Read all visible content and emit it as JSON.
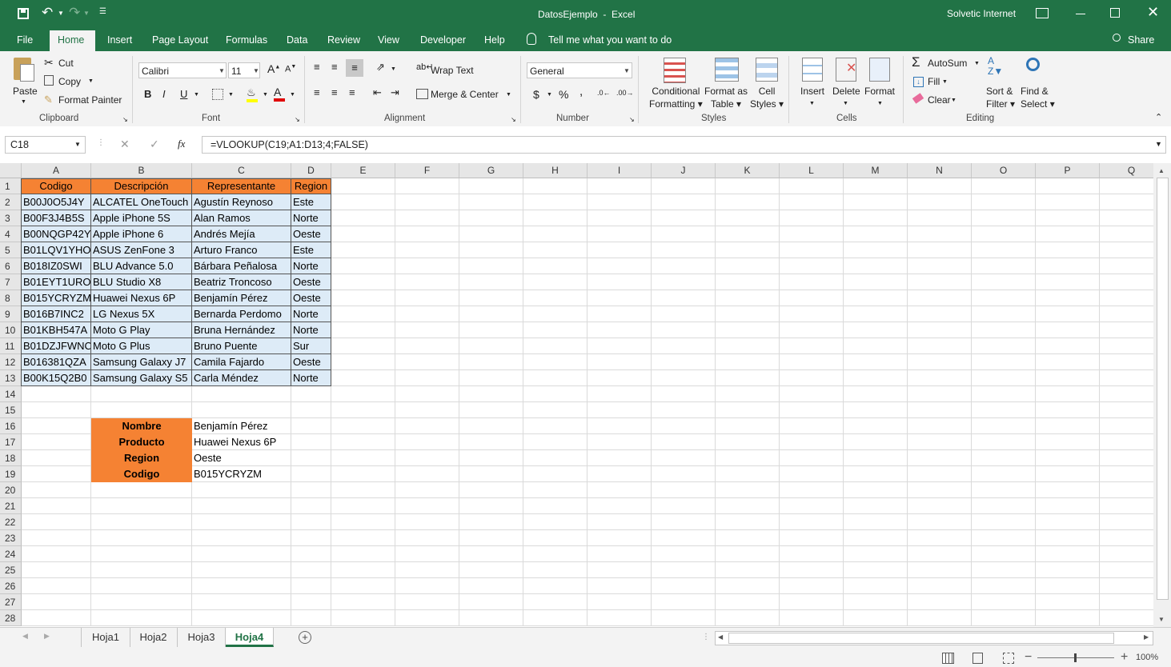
{
  "window": {
    "file_name": "DatosEjemplo",
    "app": "Excel",
    "title_separator": "  -  ",
    "user": "Solvetic Internet"
  },
  "tabs": [
    "File",
    "Home",
    "Insert",
    "Page Layout",
    "Formulas",
    "Data",
    "Review",
    "View",
    "Developer",
    "Help"
  ],
  "tell_me": "Tell me what you want to do",
  "share": "Share",
  "ribbon": {
    "clipboard": {
      "paste": "Paste",
      "cut": "Cut",
      "copy": "Copy",
      "format_painter": "Format Painter",
      "label": "Clipboard"
    },
    "font": {
      "name": "Calibri",
      "size": "11",
      "bold": "B",
      "italic": "I",
      "underline": "U",
      "label": "Font"
    },
    "alignment": {
      "wrap": "Wrap Text",
      "merge": "Merge & Center",
      "label": "Alignment"
    },
    "number": {
      "format": "General",
      "currency": "$",
      "percent": "%",
      "comma": ",",
      "label": "Number"
    },
    "styles": {
      "conditional": "Conditional",
      "conditional2": "Formatting",
      "format_as": "Format as",
      "format_as2": "Table",
      "cell": "Cell",
      "cell2": "Styles",
      "label": "Styles"
    },
    "cells": {
      "insert": "Insert",
      "delete": "Delete",
      "format": "Format",
      "label": "Cells"
    },
    "editing": {
      "autosum": "AutoSum",
      "fill": "Fill",
      "clear": "Clear",
      "sort": "Sort &",
      "sort2": "Filter",
      "find": "Find &",
      "find2": "Select",
      "label": "Editing"
    }
  },
  "formula_bar": {
    "name_box": "C18",
    "fx": "fx",
    "formula": "=VLOOKUP(C19;A1:D13;4;FALSE)"
  },
  "columns": [
    "A",
    "B",
    "C",
    "D",
    "E",
    "F",
    "G",
    "H",
    "I",
    "J",
    "K",
    "L",
    "M",
    "N",
    "O",
    "P",
    "Q"
  ],
  "rows": [
    "1",
    "2",
    "3",
    "4",
    "5",
    "6",
    "7",
    "8",
    "9",
    "10",
    "11",
    "12",
    "13",
    "14",
    "15",
    "16",
    "17",
    "18",
    "19",
    "20",
    "21",
    "22",
    "23",
    "24",
    "25",
    "26",
    "27",
    "28"
  ],
  "table": {
    "headers": [
      "Codigo",
      "Descripción",
      "Representante",
      "Region"
    ],
    "data": [
      [
        "B00J0O5J4Y",
        "ALCATEL OneTouch",
        "Agustín Reynoso",
        "Este"
      ],
      [
        "B00F3J4B5S",
        "Apple iPhone 5S",
        "Alan Ramos",
        "Norte"
      ],
      [
        "B00NQGP42Y",
        "Apple iPhone 6",
        "Andrés Mejía",
        "Oeste"
      ],
      [
        "B01LQV1YHO",
        "ASUS ZenFone 3",
        "Arturo Franco",
        "Este"
      ],
      [
        "B018IZ0SWI",
        "BLU Advance 5.0",
        "Bárbara Peñalosa",
        "Norte"
      ],
      [
        "B01EYT1URO",
        "BLU Studio X8",
        "Beatriz Troncoso",
        "Oeste"
      ],
      [
        "B015YCRYZM",
        "Huawei Nexus 6P",
        "Benjamín Pérez",
        "Oeste"
      ],
      [
        "B016B7INC2",
        "LG Nexus 5X",
        "Bernarda Perdomo",
        "Norte"
      ],
      [
        "B01KBH547A",
        "Moto G Play",
        "Bruna Hernández",
        "Norte"
      ],
      [
        "B01DZJFWNC",
        "Moto G Plus",
        "Bruno Puente",
        "Sur"
      ],
      [
        "B016381QZA",
        "Samsung Galaxy J7",
        "Camila Fajardo",
        "Oeste"
      ],
      [
        "B00K15Q2B0",
        "Samsung Galaxy S5",
        "Carla Méndez",
        "Norte"
      ]
    ]
  },
  "lookup": [
    {
      "label": "Nombre",
      "value": "Benjamín Pérez"
    },
    {
      "label": "Producto",
      "value": "Huawei Nexus 6P"
    },
    {
      "label": "Region",
      "value": "Oeste"
    },
    {
      "label": "Codigo",
      "value": "B015YCRYZM"
    }
  ],
  "sheets": [
    "Hoja1",
    "Hoja2",
    "Hoja3",
    "Hoja4"
  ],
  "active_sheet": "Hoja4",
  "zoom": "100%",
  "colors": {
    "excel_green": "#217346",
    "header_orange": "#f58233",
    "row_blue": "#ddebf7"
  }
}
